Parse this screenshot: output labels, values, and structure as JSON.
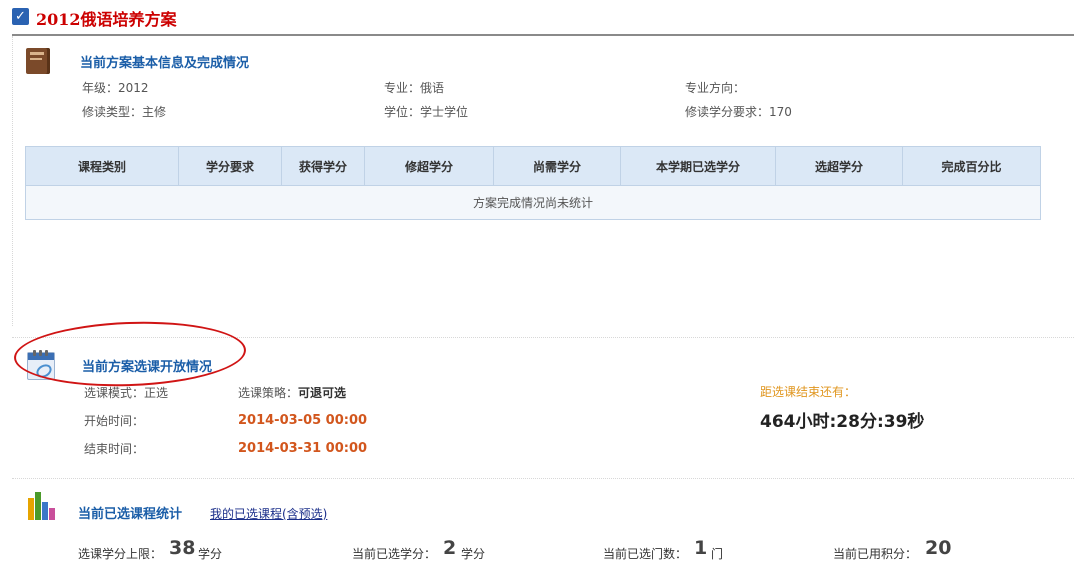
{
  "page_title": "2012俄语培养方案",
  "basic_info": {
    "section_title": "当前方案基本信息及完成情况",
    "grade": "年级：2012",
    "major": "专业：俄语",
    "direction": "专业方向：",
    "study_type": "修读类型：主修",
    "degree": "学位：学士学位",
    "credit_required": "修读学分要求：170"
  },
  "completion_table": {
    "headers": [
      "课程类别",
      "学分要求",
      "获得学分",
      "修超学分",
      "尚需学分",
      "本学期已选学分",
      "选超学分",
      "完成百分比"
    ],
    "empty_message": "方案完成情况尚未统计"
  },
  "selection_open": {
    "section_title": "当前方案选课开放情况",
    "mode": "选课模式：正选",
    "policy_label": "选课策略：",
    "policy_value": "可退可选",
    "start_label": "开始时间：",
    "start_value": "2014-03-05 00:00",
    "end_label": "结束时间：",
    "end_value": "2014-03-31 00:00",
    "countdown_label": "距选课结束还有：",
    "countdown_value": "464小时:28分:39秒"
  },
  "selected_stats": {
    "section_title": "当前已选课程统计",
    "my_courses_link": "我的已选课程(含预选)",
    "credit_limit_label": "选课学分上限：",
    "credit_limit_value": "38",
    "credit_limit_unit": "学分",
    "selected_credits_label": "当前已选学分：",
    "selected_credits_value": "2",
    "selected_credits_unit": "学分",
    "selected_count_label": "当前已选门数：",
    "selected_count_value": "1",
    "selected_count_unit": "门",
    "points_used_label": "当前已用积分：",
    "points_used_value": "20"
  },
  "colors": {
    "title_red": "#cc0000",
    "section_blue": "#1b5ea8",
    "time_orange": "#d2561d",
    "countdown_label": "#e0961f",
    "annotation_ellipse": "#d01414"
  },
  "icons": [
    "checkbox-icon",
    "book-icon",
    "calendar-icon",
    "bar-chart-icon"
  ]
}
